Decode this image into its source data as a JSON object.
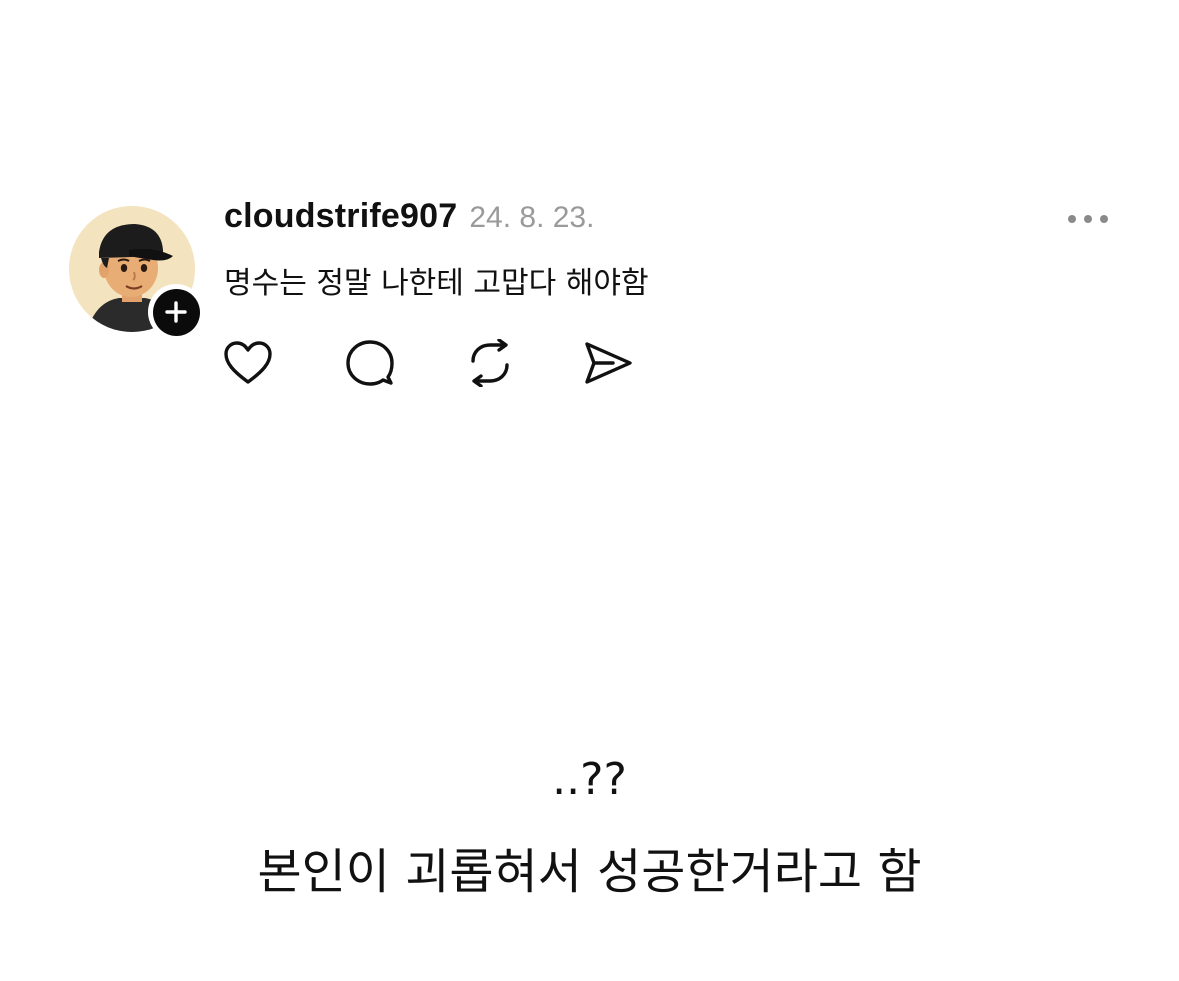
{
  "post": {
    "username": "cloudstrife907",
    "timestamp": "24. 8. 23.",
    "text": "명수는 정말 나한테 고맙다 해야함",
    "avatar_icon": "cartoon-avatar-icon",
    "follow_icon": "plus-icon",
    "more_icon": "more-horizontal-icon",
    "actions": [
      {
        "name": "like",
        "icon": "heart-icon"
      },
      {
        "name": "comment",
        "icon": "speech-bubble-icon"
      },
      {
        "name": "repost",
        "icon": "repost-icon"
      },
      {
        "name": "share",
        "icon": "send-icon"
      }
    ]
  },
  "caption": {
    "line1": "..??",
    "line2": "본인이 괴롭혀서 성공한거라고 함"
  },
  "colors": {
    "text": "#111111",
    "muted": "#9a9a9a",
    "background": "#ffffff",
    "badge": "#0b0b0b"
  }
}
